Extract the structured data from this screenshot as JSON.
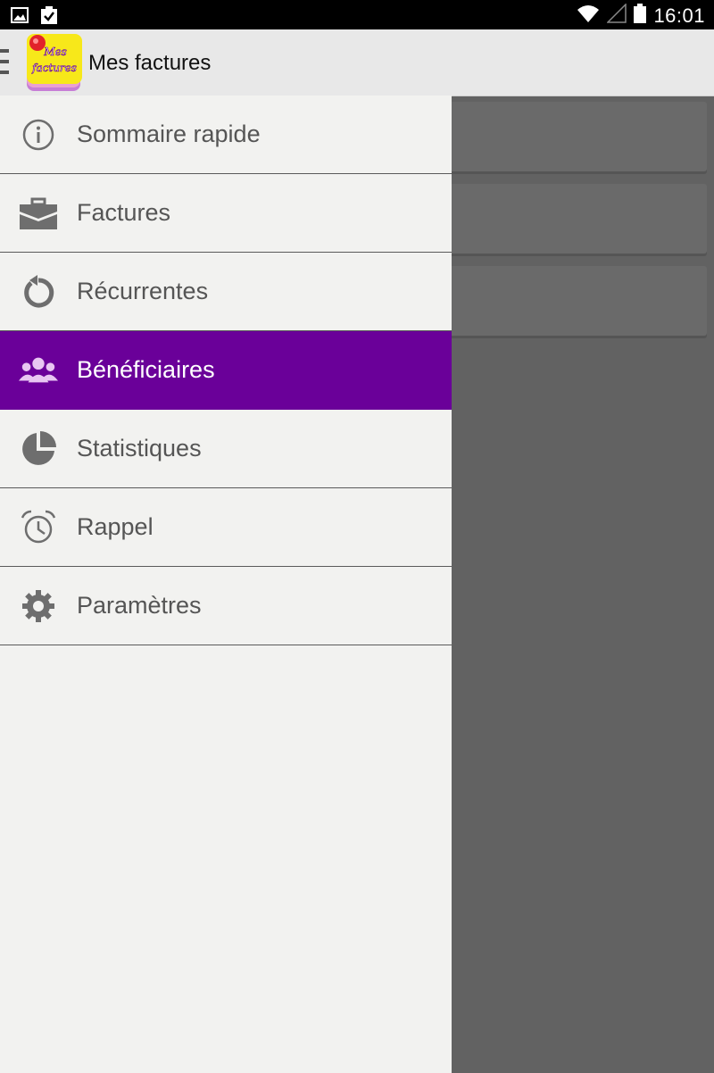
{
  "status_bar": {
    "time": "16:01",
    "icons": [
      "image-icon",
      "clipboard-check-icon",
      "wifi-icon",
      "signal-icon",
      "battery-icon"
    ]
  },
  "action_bar": {
    "logo_text_top": "Mes",
    "logo_text_bottom": "factures",
    "title": "Mes factures"
  },
  "drawer": {
    "items": [
      {
        "label": "Sommaire rapide",
        "icon": "info-icon"
      },
      {
        "label": "Factures",
        "icon": "briefcase-icon"
      },
      {
        "label": "Récurrentes",
        "icon": "refresh-icon"
      },
      {
        "label": "Bénéficiaires",
        "icon": "people-icon",
        "active": true
      },
      {
        "label": "Statistiques",
        "icon": "pie-chart-icon"
      },
      {
        "label": "Rappel",
        "icon": "alarm-icon"
      },
      {
        "label": "Paramètres",
        "icon": "gear-icon"
      }
    ]
  },
  "colors": {
    "accent": "#6a0099",
    "drawer_bg": "#f2f2f0",
    "scrim": "#626262",
    "icon_gray": "#6e6e6e"
  }
}
